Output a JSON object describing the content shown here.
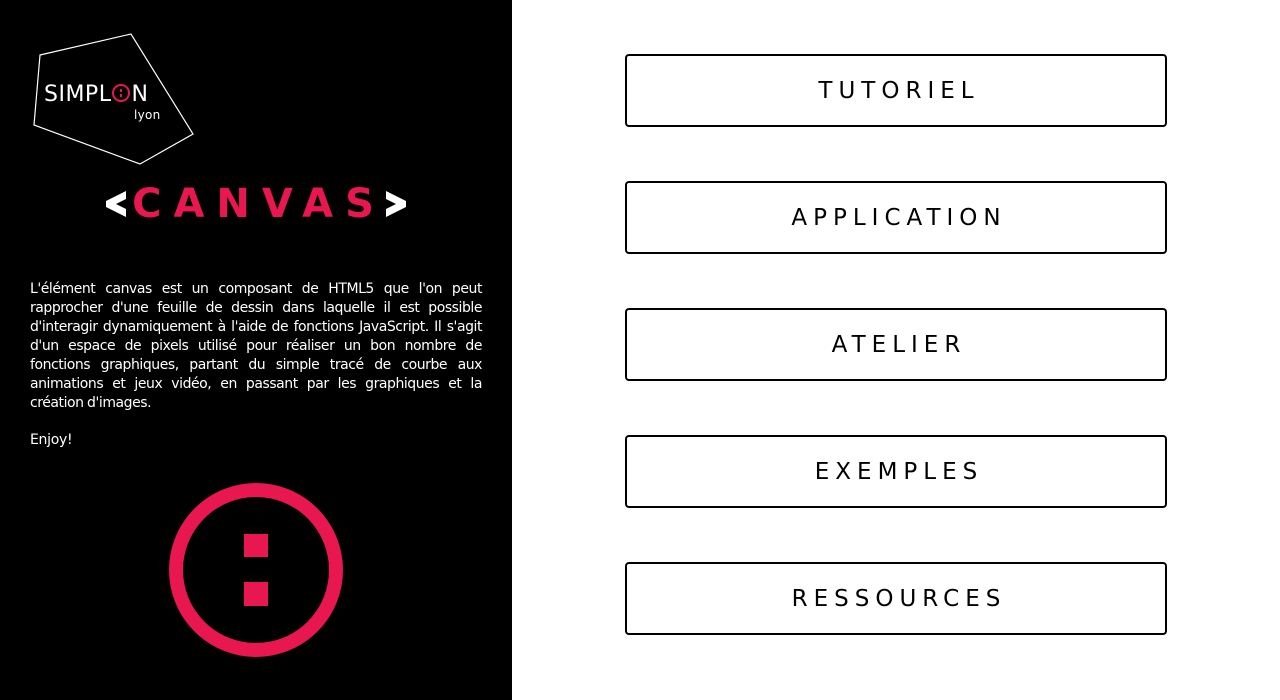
{
  "sidebar": {
    "logo": {
      "text_before": "SIMPL",
      "text_after": "N",
      "subtext": "lyon",
      "icon": "simplon-logo-icon"
    },
    "title": "CANVAS",
    "title_prefix_icon": "chevron-left-icon",
    "title_suffix_icon": "chevron-right-icon",
    "description": "L'élément canvas est un composant de HTML5 que l'on peut rapprocher d'une feuille de dessin dans laquelle il est possible d'interagir dynamiquement à l'aide de fonctions JavaScript. Il s'agit d'un espace de pixels utilisé pour réaliser un bon nombre de fonctions graphiques, partant du simple tracé de courbe aux animations et jeux vidéo, en passant par les graphiques et la création d'images.",
    "closing": "Enjoy!",
    "emblem_icon": "simplon-emblem-icon"
  },
  "menu": {
    "items": [
      {
        "label": "TUTORIEL"
      },
      {
        "label": "APPLICATION"
      },
      {
        "label": "ATELIER"
      },
      {
        "label": "EXEMPLES"
      },
      {
        "label": "RESSOURCES"
      }
    ]
  },
  "colors": {
    "accent": "#e8174f",
    "sidebar_bg": "#000000",
    "main_bg": "#ffffff"
  }
}
